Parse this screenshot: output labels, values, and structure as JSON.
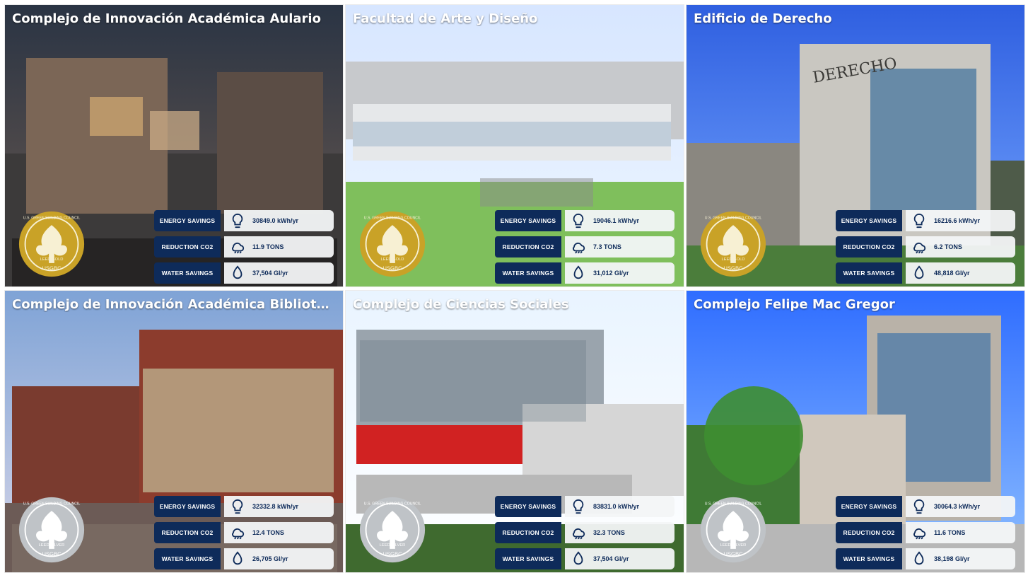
{
  "tiles": [
    {
      "title": "Complejo de Innovación Académica Aulario",
      "badge": {
        "top": "U.S. GREEN BUILDING COUNCIL",
        "middle": "LEED GOLD",
        "bottom": "USGBC",
        "level": "gold"
      },
      "stats": {
        "energy_label": "ENERGY SAVINGS",
        "energy_value": "30849.0 kWh/yr",
        "co2_label": "REDUCTION CO2",
        "co2_value": "11.9 TONS",
        "water_label": "WATER SAVINGS",
        "water_value": "37,504 Gl/yr"
      }
    },
    {
      "title": "Facultad de Arte y Diseño",
      "badge": {
        "top": "U.S. GREEN BUILDING COUNCIL",
        "middle": "LEED GOLD",
        "bottom": "USGBC",
        "level": "gold"
      },
      "stats": {
        "energy_label": "ENERGY SAVINGS",
        "energy_value": "19046.1 kWh/yr",
        "co2_label": "REDUCTION CO2",
        "co2_value": "7.3 TONS",
        "water_label": "WATER SAVINGS",
        "water_value": "31,012 Gl/yr"
      }
    },
    {
      "title": "Edificio de Derecho",
      "badge": {
        "top": "U.S. GREEN BUILDING COUNCIL",
        "middle": "LEED GOLD",
        "bottom": "USGBC",
        "level": "gold"
      },
      "stats": {
        "energy_label": "ENERGY SAVINGS",
        "energy_value": "16216.6 kWh/yr",
        "co2_label": "REDUCTION CO2",
        "co2_value": "6.2 TONS",
        "water_label": "WATER SAVINGS",
        "water_value": "48,818 Gl/yr"
      }
    },
    {
      "title": "Complejo de Innovación Académica Biblioteca",
      "badge": {
        "top": "U.S. GREEN BUILDING COUNCIL",
        "middle": "LEED SILVER",
        "bottom": "USGBC",
        "level": "silver"
      },
      "stats": {
        "energy_label": "ENERGY SAVINGS",
        "energy_value": "32332.8 kWh/yr",
        "co2_label": "REDUCTION CO2",
        "co2_value": "12.4 TONS",
        "water_label": "WATER SAVINGS",
        "water_value": "26,705 Gl/yr"
      }
    },
    {
      "title": "Complejo de Ciencias Sociales",
      "badge": {
        "top": "U.S. GREEN BUILDING COUNCIL",
        "middle": "LEED SILVER",
        "bottom": "USGBC",
        "level": "silver"
      },
      "stats": {
        "energy_label": "ENERGY SAVINGS",
        "energy_value": "83831.0 kWh/yr",
        "co2_label": "REDUCTION CO2",
        "co2_value": "32.3 TONS",
        "water_label": "WATER SAVINGS",
        "water_value": "37,504 Gl/yr"
      }
    },
    {
      "title": "Complejo Felipe Mac Gregor",
      "badge": {
        "top": "U.S. GREEN BUILDING COUNCIL",
        "middle": "LEED SILVER",
        "bottom": "USGBC",
        "level": "silver"
      },
      "stats": {
        "energy_label": "ENERGY SAVINGS",
        "energy_value": "30064.3 kWh/yr",
        "co2_label": "REDUCTION CO2",
        "co2_value": "11.6 TONS",
        "water_label": "WATER SAVINGS",
        "water_value": "38,198 Gl/yr"
      }
    }
  ],
  "colors": {
    "label_bg": "#0e2b5a",
    "value_bg": "#f3f5f7",
    "gold": "#c9a227",
    "silver": "#bfc3c7"
  }
}
